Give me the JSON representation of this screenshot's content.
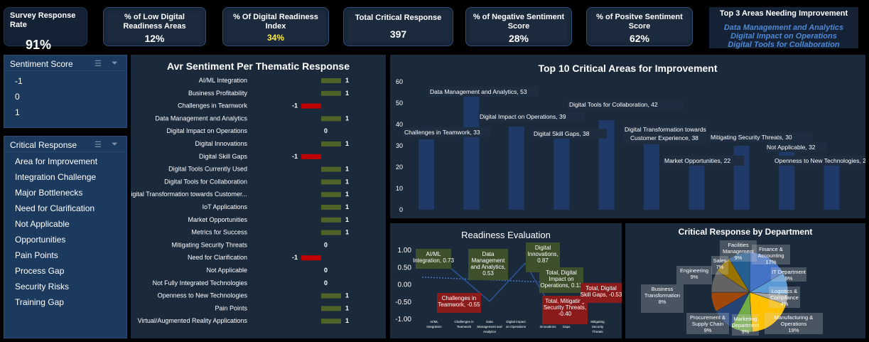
{
  "kpis": [
    {
      "title": "Survey Response Rate",
      "value": "91%",
      "color": "#ffffff"
    },
    {
      "title": "% of Low Digital Readiness Areas",
      "value": "12%",
      "color": "#ffffff"
    },
    {
      "title": "% Of Digital Readiness Index",
      "value": "34%",
      "color": "#ffeb3b"
    },
    {
      "title": "Total Critical Response",
      "value": "397",
      "color": "#ffffff"
    },
    {
      "title": "% of Negative Sentiment Score",
      "value": "28%",
      "color": "#ffffff"
    },
    {
      "title": "% of Positve Sentiment Score",
      "value": "62%",
      "color": "#ffffff"
    }
  ],
  "top3": {
    "title": "Top 3 Areas Needing Improvement",
    "items": [
      "Data Management and Analytics",
      "Digital Impact on Operations",
      "Digital Tools for Collaboration"
    ]
  },
  "slicer_sentiment": {
    "title": "Sentiment Score",
    "items": [
      "-1",
      "0",
      "1"
    ]
  },
  "slicer_critical": {
    "title": "Critical Response",
    "items": [
      "Area for Improvement",
      "Integration Challenge",
      "Major Bottlenecks",
      "Need for Clarification",
      "Not Applicable",
      "Opportunities",
      "Pain Points",
      "Process Gap",
      "Security Risks",
      "Training Gap"
    ]
  },
  "chart_data": [
    {
      "type": "bar",
      "orientation": "horizontal",
      "title": "Avr Sentiment Per Thematic Response",
      "categories": [
        "AI/ML Integration",
        "Business Profitability",
        "Challenges in Teamwork",
        "Data Management and Analytics",
        "Digital Impact on Operations",
        "Digital Innovations",
        "Digital Skill Gaps",
        "Digital Tools Currently Used",
        "Digital Tools for Collaboration",
        "Digital Transformation towards Customer...",
        "IoT Applications",
        "Market Opportunities",
        "Metrics for Success",
        "Mitigating Security Threats",
        "Need for Clarification",
        "Not Applicable",
        "Not Fully Integrated Technologies",
        "Openness to New Technologies",
        "Pain Points",
        "Virtual/Augmented Reality Applications"
      ],
      "values": [
        1,
        1,
        -1,
        1,
        0,
        1,
        -1,
        1,
        1,
        1,
        1,
        1,
        1,
        0,
        -1,
        0,
        0,
        1,
        1,
        1
      ],
      "positive_color": "#4f6228",
      "negative_color": "#c00000"
    },
    {
      "type": "bar",
      "title": "Top 10 Critical Areas for Improvement",
      "categories": [
        "Challenges in Teamwork",
        "Data Management and Analytics",
        "Digital Impact on Operations",
        "Digital Skill Gaps",
        "Digital Tools for Collaboration",
        "Digital Transformation towards Customer Experience",
        "Market Opportunities",
        "Mitigating Security Threats",
        "Not Applicable",
        "Openness to New Technologies"
      ],
      "values": [
        33,
        53,
        39,
        38,
        42,
        38,
        22,
        30,
        32,
        23
      ],
      "ylim": [
        0,
        60
      ],
      "yticks": [
        0,
        10,
        20,
        30,
        40,
        50,
        60
      ],
      "bar_color": "#1f3a68"
    },
    {
      "type": "line",
      "title": "Readiness Evaluation",
      "categories": [
        "AI/ML Integration",
        "Challenges in Teamwork",
        "Data Management and Analytics",
        "Digital Impact on Operations",
        "Digital Innovations",
        "Digital Skill Gaps",
        "Mitigating Security Threats"
      ],
      "points": [
        {
          "label": "AI/ML Integration, 0.73",
          "value": 0.73,
          "color": "#3d4f2b"
        },
        {
          "label": "Challenges in Teamwork, -0.55",
          "value": -0.55,
          "color": "#8b1a1a"
        },
        {
          "label": "Data Management and Analytics, 0.53",
          "value": 0.53,
          "color": "#3d4f2b"
        },
        {
          "label": "Digital Innovations, 0.87",
          "value": 0.87,
          "color": "#3d4f2b"
        },
        {
          "label": "Total, Digital Impact on Operations, 0.13",
          "value": 0.13,
          "color": "#3d4f2b"
        },
        {
          "label": "Total, Mitigating Security Threats, -0.40",
          "value": -0.4,
          "color": "#8b1a1a"
        },
        {
          "label": "Total, Digital Skill Gaps, -0.53",
          "value": -0.53,
          "color": "#8b1a1a"
        }
      ],
      "ylim": [
        -1,
        1
      ],
      "yticks": [
        "1.00",
        "0.50",
        "0.00",
        "-0.50",
        "-1.00"
      ]
    },
    {
      "type": "pie",
      "title": "Critical Response by Department",
      "slices": [
        {
          "name": "Finance & Accounting",
          "value": 17,
          "label": "17%",
          "color": "#4472c4"
        },
        {
          "name": "IT Department",
          "value": 9,
          "label": "9%",
          "color": "#5b9bd5"
        },
        {
          "name": "Logistics & Compliance",
          "value": 4,
          "label": "4%",
          "color": "#a5a5a5"
        },
        {
          "name": "Manufacturing & Operations",
          "value": 19,
          "label": "19%",
          "color": "#ffc000"
        },
        {
          "name": "Marketing Department",
          "value": 9,
          "label": "9%",
          "color": "#70ad47"
        },
        {
          "name": "Procurement & Supply Chain",
          "value": 9,
          "label": "9%",
          "color": "#264478"
        },
        {
          "name": "Business Transformation",
          "value": 8,
          "label": "8%",
          "color": "#9e480e"
        },
        {
          "name": "Engineering",
          "value": 9,
          "label": "9%",
          "color": "#636363"
        },
        {
          "name": "Sales",
          "value": 7,
          "label": "7%",
          "color": "#997300"
        },
        {
          "name": "Facilities Management",
          "value": 9,
          "label": "9%",
          "color": "#255e91"
        }
      ]
    }
  ]
}
